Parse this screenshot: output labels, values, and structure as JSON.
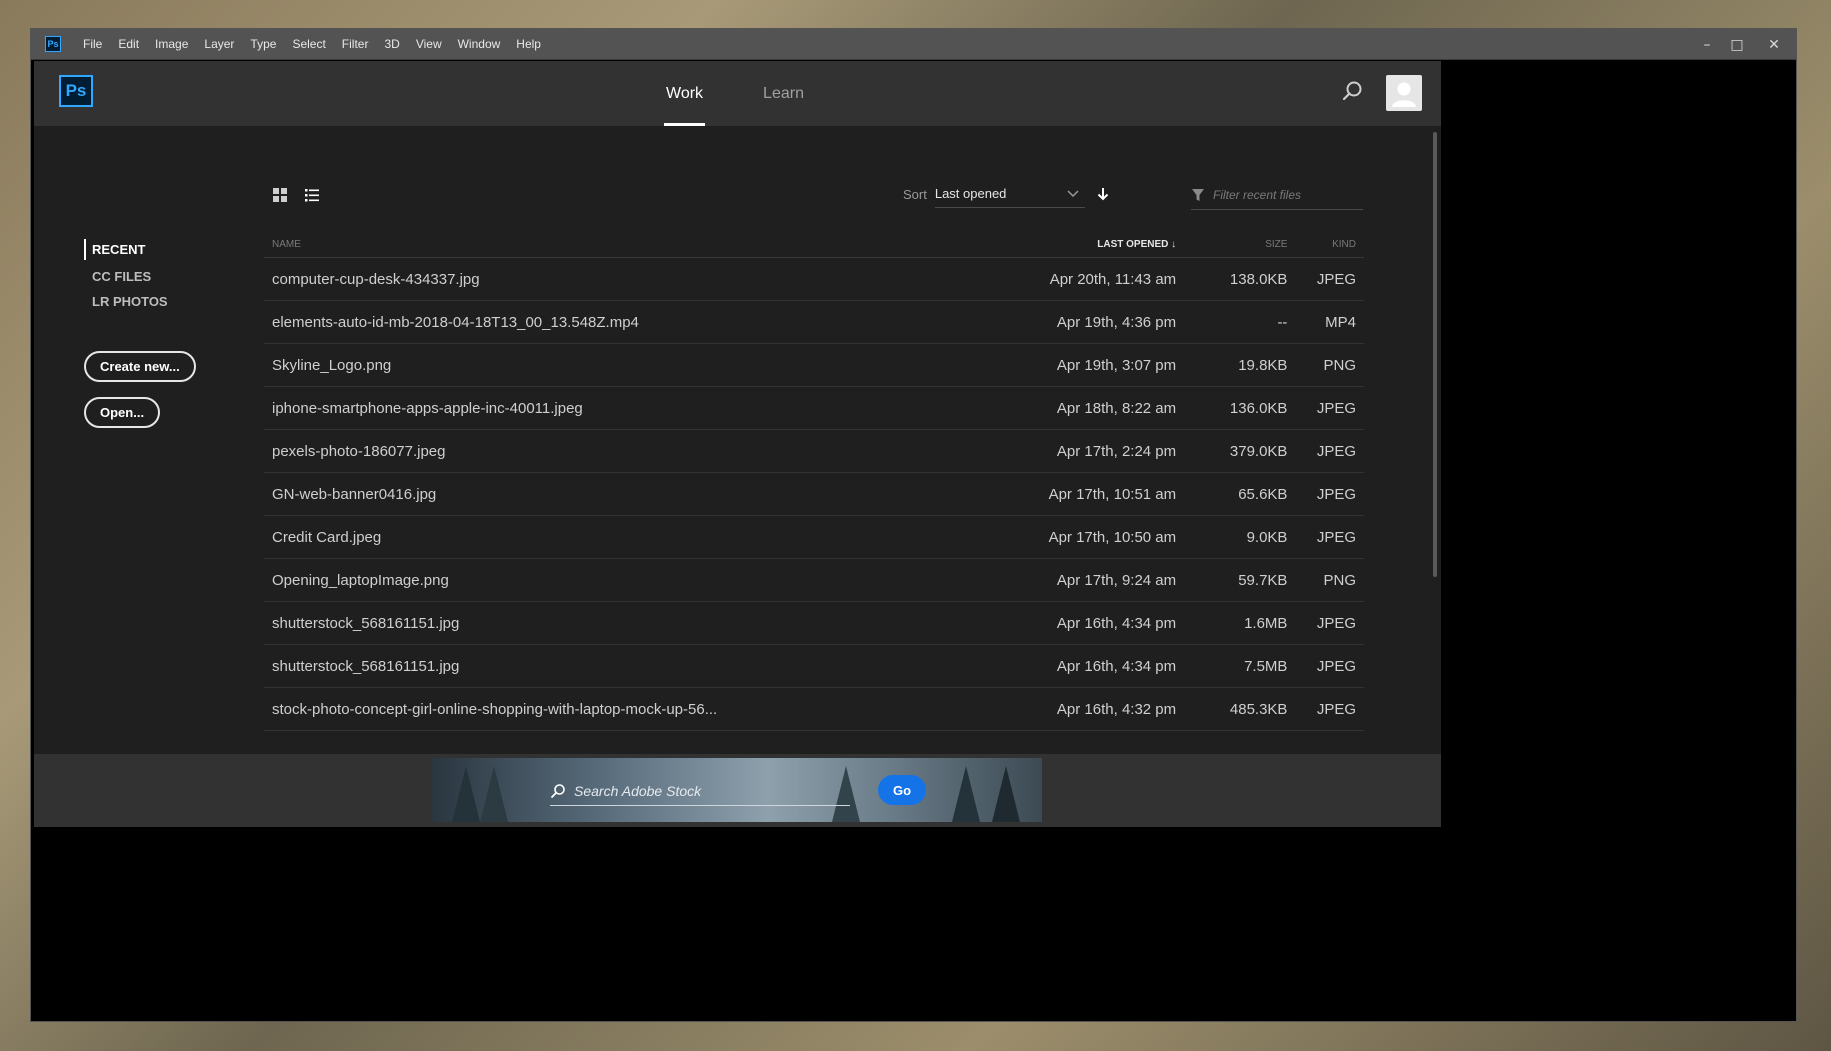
{
  "app": {
    "icon_label": "Ps",
    "menu": [
      "File",
      "Edit",
      "Image",
      "Layer",
      "Type",
      "Select",
      "Filter",
      "3D",
      "View",
      "Window",
      "Help"
    ],
    "window_controls": {
      "minimize": "–",
      "maximize": "□",
      "close": "✕"
    }
  },
  "header": {
    "logo": "Ps",
    "tabs": [
      {
        "label": "Work",
        "active": true
      },
      {
        "label": "Learn",
        "active": false
      }
    ]
  },
  "sidebar": {
    "items": [
      {
        "label": "RECENT",
        "active": true
      },
      {
        "label": "CC FILES",
        "active": false
      },
      {
        "label": "LR PHOTOS",
        "active": false
      }
    ],
    "create_label": "Create new...",
    "open_label": "Open..."
  },
  "toolbar": {
    "sort_label": "Sort",
    "sort_value": "Last opened",
    "filter_placeholder": "Filter recent files"
  },
  "table": {
    "headers": {
      "name": "NAME",
      "last_opened": "LAST OPENED ↓",
      "size": "SIZE",
      "kind": "KIND"
    },
    "rows": [
      {
        "name": "computer-cup-desk-434337.jpg",
        "date": "Apr 20th, 11:43 am",
        "size": "138.0KB",
        "kind": "JPEG"
      },
      {
        "name": "elements-auto-id-mb-2018-04-18T13_00_13.548Z.mp4",
        "date": "Apr 19th, 4:36 pm",
        "size": "--",
        "kind": "MP4"
      },
      {
        "name": "Skyline_Logo.png",
        "date": "Apr 19th, 3:07 pm",
        "size": "19.8KB",
        "kind": "PNG"
      },
      {
        "name": "iphone-smartphone-apps-apple-inc-40011.jpeg",
        "date": "Apr 18th, 8:22 am",
        "size": "136.0KB",
        "kind": "JPEG"
      },
      {
        "name": "pexels-photo-186077.jpeg",
        "date": "Apr 17th, 2:24 pm",
        "size": "379.0KB",
        "kind": "JPEG"
      },
      {
        "name": "GN-web-banner0416.jpg",
        "date": "Apr 17th, 10:51 am",
        "size": "65.6KB",
        "kind": "JPEG"
      },
      {
        "name": "Credit Card.jpeg",
        "date": "Apr 17th, 10:50 am",
        "size": "9.0KB",
        "kind": "JPEG"
      },
      {
        "name": "Opening_laptopImage.png",
        "date": "Apr 17th, 9:24 am",
        "size": "59.7KB",
        "kind": "PNG"
      },
      {
        "name": "shutterstock_568161151.jpg",
        "date": "Apr 16th, 4:34 pm",
        "size": "1.6MB",
        "kind": "JPEG"
      },
      {
        "name": "shutterstock_568161151.jpg",
        "date": "Apr 16th, 4:34 pm",
        "size": "7.5MB",
        "kind": "JPEG"
      },
      {
        "name": "stock-photo-concept-girl-online-shopping-with-laptop-mock-up-56...",
        "date": "Apr 16th, 4:32 pm",
        "size": "485.3KB",
        "kind": "JPEG"
      }
    ]
  },
  "stock": {
    "placeholder": "Search Adobe Stock",
    "go_label": "Go"
  },
  "colors": {
    "accent": "#31a8ff",
    "button_blue": "#1473e6",
    "panel": "#1f1f1f",
    "header": "#323232"
  }
}
